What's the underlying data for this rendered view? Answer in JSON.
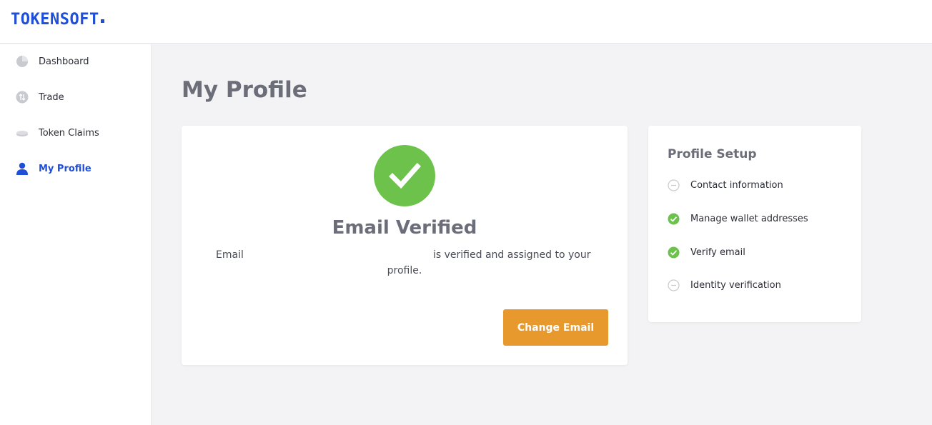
{
  "brand": {
    "logo_text": "TOKENSOFT",
    "accent_color": "#1f4fd8"
  },
  "sidebar": {
    "items": [
      {
        "label": "Dashboard",
        "icon": "pie-chart-icon",
        "active": false
      },
      {
        "label": "Trade",
        "icon": "trade-arrows-icon",
        "active": false
      },
      {
        "label": "Token Claims",
        "icon": "coins-icon",
        "active": false
      },
      {
        "label": "My Profile",
        "icon": "user-icon",
        "active": true
      }
    ]
  },
  "main": {
    "title": "My Profile",
    "email_card": {
      "status_title": "Email Verified",
      "message_prefix": "Email",
      "message_suffix_line1": "is verified and assigned to your",
      "message_suffix_line2": "profile.",
      "change_button_label": "Change Email",
      "success_color": "#6cc24a",
      "button_color": "#e8992e"
    },
    "profile_setup": {
      "title": "Profile Setup",
      "steps": [
        {
          "label": "Contact information",
          "status": "incomplete"
        },
        {
          "label": "Manage wallet addresses",
          "status": "complete"
        },
        {
          "label": "Verify email",
          "status": "complete"
        },
        {
          "label": "Identity verification",
          "status": "incomplete"
        }
      ]
    }
  }
}
